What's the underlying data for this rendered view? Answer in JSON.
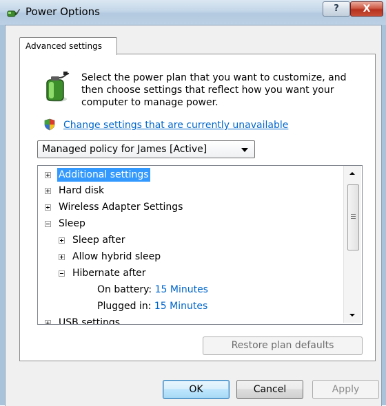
{
  "window": {
    "title": "Power Options",
    "help_glyph": "?",
    "close_glyph": "X"
  },
  "tab": {
    "label": "Advanced settings"
  },
  "description": "Select the power plan that you want to customize, and then choose settings that reflect how you want your computer to manage power.",
  "change_link": "Change settings that are currently unavailable",
  "plan_select": {
    "value": "Managed policy for James [Active]"
  },
  "tree": {
    "additional": "Additional settings",
    "hard_disk": "Hard disk",
    "wireless": "Wireless Adapter Settings",
    "sleep": "Sleep",
    "sleep_after": "Sleep after",
    "hybrid": "Allow hybrid sleep",
    "hibernate": "Hibernate after",
    "on_battery_label": "On battery:",
    "on_battery_value": "15 Minutes",
    "plugged_label": "Plugged in:",
    "plugged_value": "15 Minutes",
    "usb": "USB settings"
  },
  "buttons": {
    "restore": "Restore plan defaults",
    "ok": "OK",
    "cancel": "Cancel",
    "apply": "Apply"
  },
  "icons": {
    "title": "power-options-icon",
    "battery": "battery-plug-icon",
    "shield": "uac-shield-icon"
  },
  "colors": {
    "link": "#0066cc",
    "selection": "#3399ff",
    "titlebar": "#c3d6e8",
    "close": "#c64c36"
  }
}
